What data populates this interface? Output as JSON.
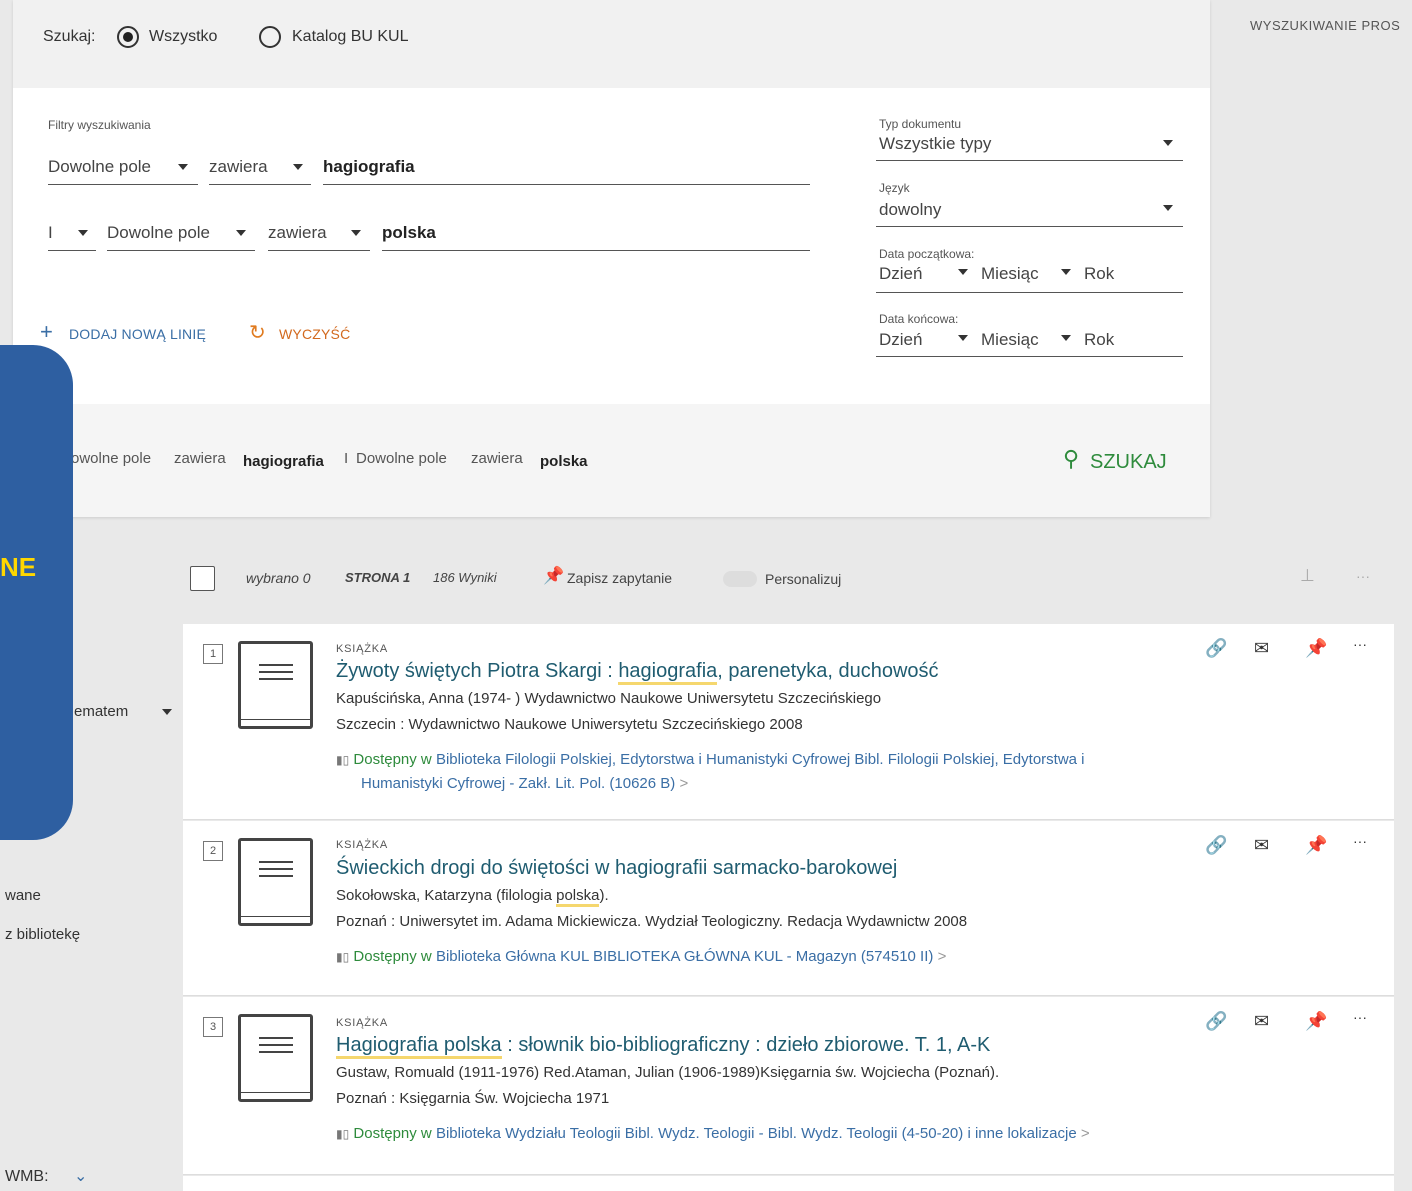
{
  "scope": {
    "label": "Szukaj:",
    "options": [
      "Wszystko",
      "Katalog BU KUL"
    ],
    "selected": "Wszystko"
  },
  "right_header": "WYSZUKIWANIE PROS",
  "filters": {
    "label": "Filtry wyszukiwania",
    "row1": {
      "field": "Dowolne pole",
      "operator": "zawiera",
      "value": "hagiografia"
    },
    "row2": {
      "boolean": "I",
      "field": "Dowolne pole",
      "operator": "zawiera",
      "value": "polska"
    },
    "add_line": "DODAJ NOWĄ LINIĘ",
    "clear": "WYCZYŚĆ"
  },
  "side_filters": {
    "doc_type_label": "Typ dokumentu",
    "doc_type_value": "Wszystkie typy",
    "lang_label": "Język",
    "lang_value": "dowolny",
    "start_date_label": "Data początkowa:",
    "end_date_label": "Data końcowa:",
    "day": "Dzień",
    "month": "Miesiąc",
    "year": "Rok"
  },
  "summary": {
    "part1": "owolne pole",
    "part2": "zawiera",
    "part3": "hagiografia",
    "part4": "I",
    "part5": "Dowolne pole",
    "part6": "zawiera",
    "part7": "polska",
    "search_button": "SZUKAJ"
  },
  "overlay_text": "NE",
  "left_facets": {
    "sort_partial": "ematem",
    "item1": "wane",
    "item2": "z bibliotekę",
    "wmb": "WMB:"
  },
  "results_bar": {
    "selected": "wybrano 0",
    "page": "STRONA 1",
    "count": "186 Wyniki",
    "save_query": "Zapisz zapytanie",
    "personalize": "Personalizuj"
  },
  "results": [
    {
      "num": "1",
      "type": "KSIĄŻKA",
      "title_pre": "Żywoty świętych Piotra Skargi : ",
      "title_hl": "hagiografia",
      "title_post": ", parenetyka, duchowość",
      "line1": "Kapuścińska, Anna (1974- ) Wydawnictwo Naukowe Uniwersytetu Szczecińskiego",
      "line2": "Szczecin : Wydawnictwo Naukowe Uniwersytetu Szczecińskiego 2008",
      "avail_ok": "Dostępny w",
      "avail_loc": "Biblioteka Filologii Polskiej, Edytorstwa i Humanistyki Cyfrowej  Bibl. Filologii Polskiej, Edytorstwa i",
      "avail_loc2": "Humanistyki Cyfrowej - Zakł. Lit. Pol. (10626 B)"
    },
    {
      "num": "2",
      "type": "KSIĄŻKA",
      "title_pre": "Świeckich drogi do świętości w hagiografii sarmacko-barokowej",
      "title_hl": "",
      "title_post": "",
      "line1_pre": "Sokołowska, Katarzyna (filologia ",
      "line1_hl": "polska",
      "line1_post": ").",
      "line2": "Poznań : Uniwersytet im. Adama Mickiewicza. Wydział Teologiczny. Redacja Wydawnictw 2008",
      "avail_ok": "Dostępny w",
      "avail_loc": "Biblioteka Główna KUL  BIBLIOTEKA GŁÓWNA KUL - Magazyn (574510 II)"
    },
    {
      "num": "3",
      "type": "KSIĄŻKA",
      "title_pre": "",
      "title_hl": "Hagiografia polska",
      "title_post": " : słownik bio-bibliograficzny : dzieło zbiorowe. T. 1, A-K",
      "line1": "Gustaw, Romuald (1911-1976) Red.Ataman, Julian (1906-1989)Księgarnia św. Wojciecha (Poznań).",
      "line2": "Poznań : Księgarnia Św. Wojciecha 1971",
      "avail_ok": "Dostępny w",
      "avail_loc": "Biblioteka Wydziału Teologii  Bibl. Wydz. Teologii - Bibl. Wydz. Teologii (4-50-20) i inne lokalizacje"
    }
  ]
}
